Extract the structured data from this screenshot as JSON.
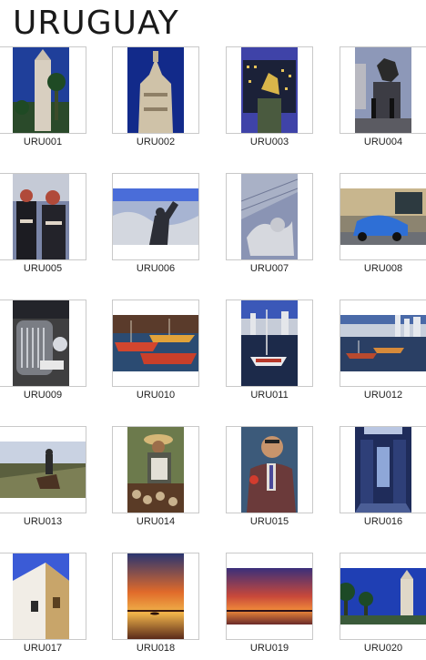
{
  "page": {
    "title": "URUGUAY"
  },
  "thumbnails": [
    {
      "id": "URU001",
      "kind": "portrait"
    },
    {
      "id": "URU002",
      "kind": "portrait"
    },
    {
      "id": "URU003",
      "kind": "portrait"
    },
    {
      "id": "URU004",
      "kind": "portrait"
    },
    {
      "id": "URU005",
      "kind": "portrait"
    },
    {
      "id": "URU006",
      "kind": "landscape"
    },
    {
      "id": "URU007",
      "kind": "portrait"
    },
    {
      "id": "URU008",
      "kind": "landscape"
    },
    {
      "id": "URU009",
      "kind": "portrait"
    },
    {
      "id": "URU010",
      "kind": "landscape"
    },
    {
      "id": "URU011",
      "kind": "portrait"
    },
    {
      "id": "URU012",
      "kind": "landscape"
    },
    {
      "id": "URU013",
      "kind": "landscape"
    },
    {
      "id": "URU014",
      "kind": "portrait"
    },
    {
      "id": "URU015",
      "kind": "portrait"
    },
    {
      "id": "URU016",
      "kind": "portrait"
    },
    {
      "id": "URU017",
      "kind": "portrait"
    },
    {
      "id": "URU018",
      "kind": "portrait"
    },
    {
      "id": "URU019",
      "kind": "landscape"
    },
    {
      "id": "URU020",
      "kind": "landscape"
    }
  ]
}
